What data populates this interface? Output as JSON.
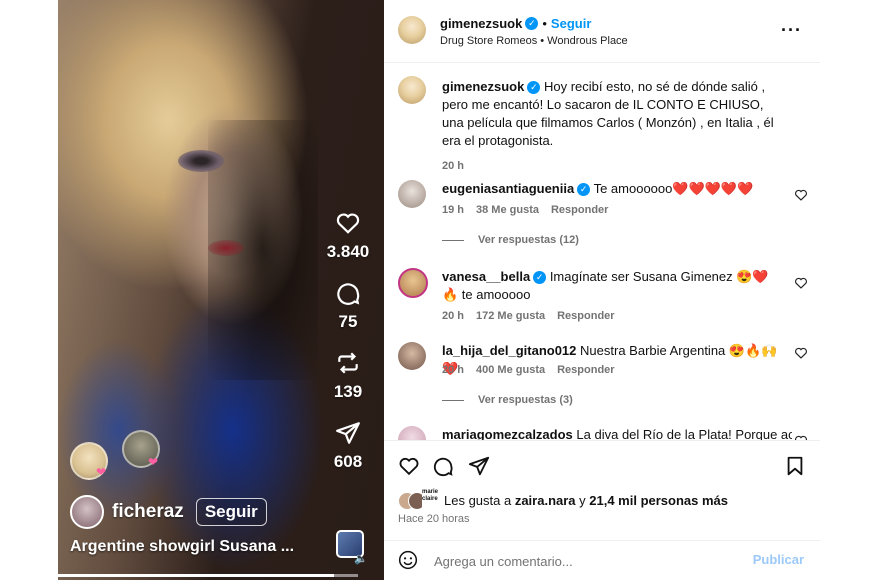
{
  "video": {
    "stats": [
      {
        "icon": "heart-icon",
        "count": "3.840"
      },
      {
        "icon": "comment-icon",
        "count": "75"
      },
      {
        "icon": "repost-icon",
        "count": "139"
      },
      {
        "icon": "share-icon",
        "count": "608"
      }
    ],
    "creator": "ficheraz",
    "follow_label": "Seguir",
    "caption": "Argentine showgirl Susana ...",
    "progress": 0.92
  },
  "post": {
    "username": "gimenezsuok",
    "follow_label": "Seguir",
    "audio_line": "Drug Store Romeos • Wondrous Place",
    "caption_username": "gimenezsuok",
    "caption_text": "Hoy recibí esto, no sé de dónde salió , pero me encantó! Lo sacaron de IL CONTO E CHIUSO, una película que filmamos Carlos ( Monzón) , en Italia , él era el protagonista.",
    "caption_time": "20 h"
  },
  "comments": [
    {
      "username": "eugeniasantiagueniia",
      "verified": true,
      "text": "Te amoooooo❤️❤️❤️❤️❤️",
      "time": "19 h",
      "likes": "38 Me gusta",
      "reply": "Responder",
      "view_replies": "Ver respuestas (12)"
    },
    {
      "username": "vanesa__bella",
      "verified": true,
      "text": "Imagínate ser Susana Gimenez 😍❤️🔥 te amooooo",
      "time": "20 h",
      "likes": "172 Me gusta",
      "reply": "Responder"
    },
    {
      "username": "la_hija_del_gitano012",
      "verified": false,
      "text": "Nuestra Barbie Argentina 😍🔥🙌❤️",
      "time": "20 h",
      "likes": "400 Me gusta",
      "reply": "Responder",
      "view_replies": "Ver respuestas (3)"
    },
    {
      "username": "mariagomezcalzados",
      "verified": false,
      "text": "La diva del Río de la Plata! Porque acá"
    }
  ],
  "likes_summary": {
    "prefix": "Les gusta a ",
    "user": "zaira.nara",
    "middle": " y ",
    "count": "21,4 mil personas más",
    "stack_label": "marie claire"
  },
  "posted_ago": "Hace 20 horas",
  "comment_box": {
    "placeholder": "Agrega un comentario...",
    "publish_label": "Publicar"
  },
  "colors": {
    "accent": "#0095f6",
    "muted": "#737373",
    "publish_disabled": "#9ccaf8"
  }
}
